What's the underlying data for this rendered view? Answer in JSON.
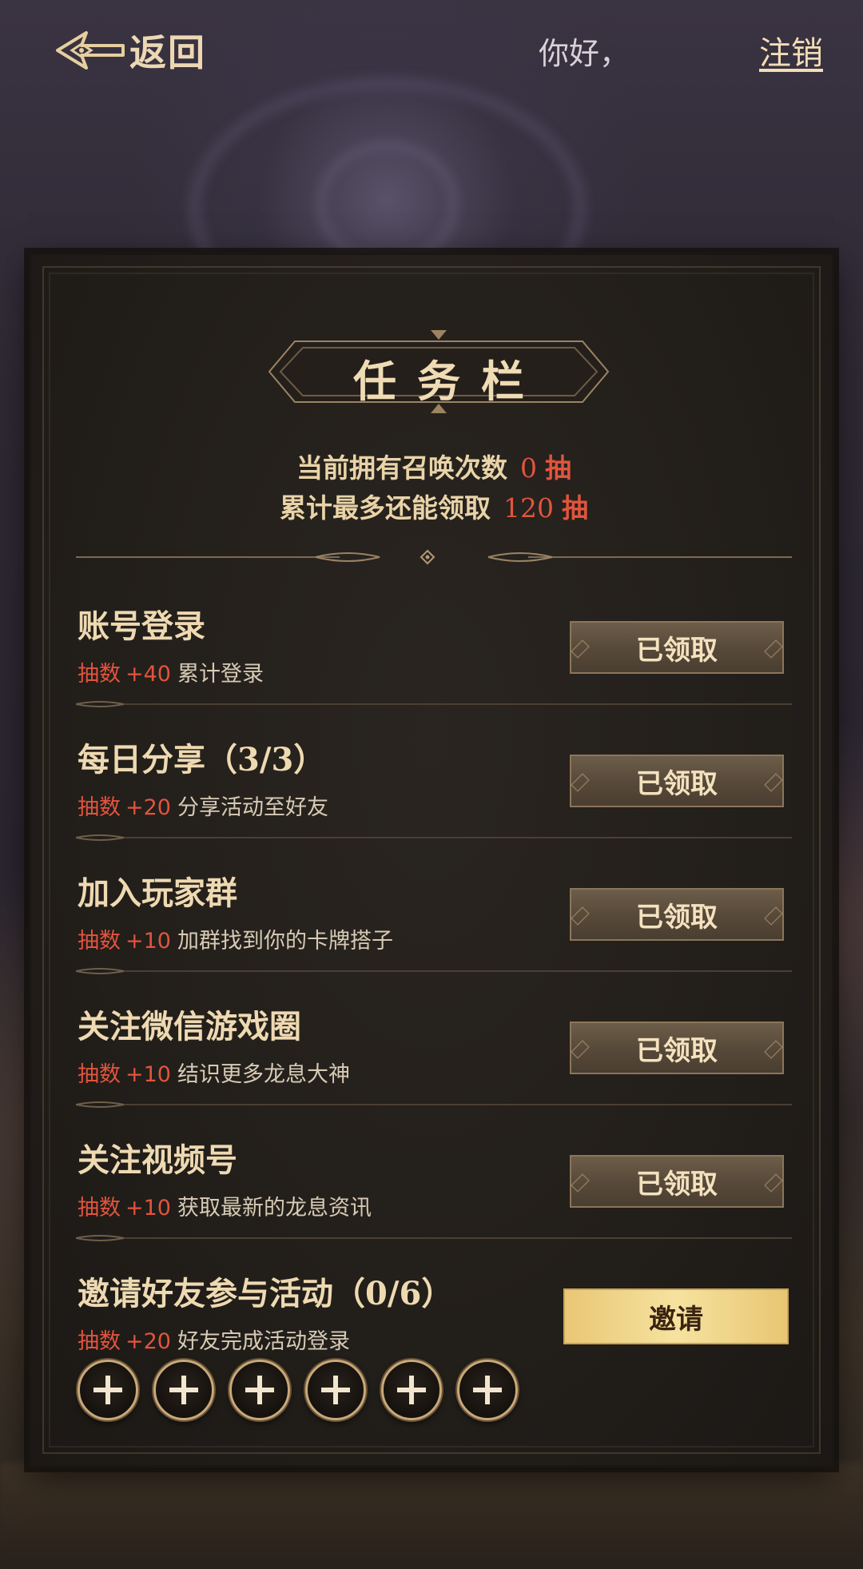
{
  "header": {
    "back_label": "返回",
    "greeting": "你好，",
    "logout_label": "注销"
  },
  "panel": {
    "title": "任务栏",
    "summary": {
      "line1_label": "当前拥有召唤次数",
      "line1_value": "0",
      "line1_unit": "抽",
      "line2_label": "累计最多还能领取",
      "line2_value": "120",
      "line2_unit": "抽"
    },
    "tasks": [
      {
        "title": "账号登录",
        "reward_label": "抽数",
        "reward_value": "+40",
        "desc": "累计登录",
        "button": "已领取"
      },
      {
        "title": "每日分享（3/3）",
        "reward_label": "抽数",
        "reward_value": "+20",
        "desc": "分享活动至好友",
        "button": "已领取"
      },
      {
        "title": "加入玩家群",
        "reward_label": "抽数",
        "reward_value": "+10",
        "desc": "加群找到你的卡牌搭子",
        "button": "已领取"
      },
      {
        "title": "关注微信游戏圈",
        "reward_label": "抽数",
        "reward_value": "+10",
        "desc": "结识更多龙息大神",
        "button": "已领取"
      },
      {
        "title": "关注视频号",
        "reward_label": "抽数",
        "reward_value": "+10",
        "desc": "获取最新的龙息资讯",
        "button": "已领取"
      },
      {
        "title": "邀请好友参与活动（0/6）",
        "reward_label": "抽数",
        "reward_value": "+20",
        "desc": "好友完成活动登录",
        "button": "邀请"
      }
    ]
  },
  "colors": {
    "accent_gold": "#e9c775",
    "reward_red": "#e2543d",
    "text_cream": "#eed9b1"
  }
}
